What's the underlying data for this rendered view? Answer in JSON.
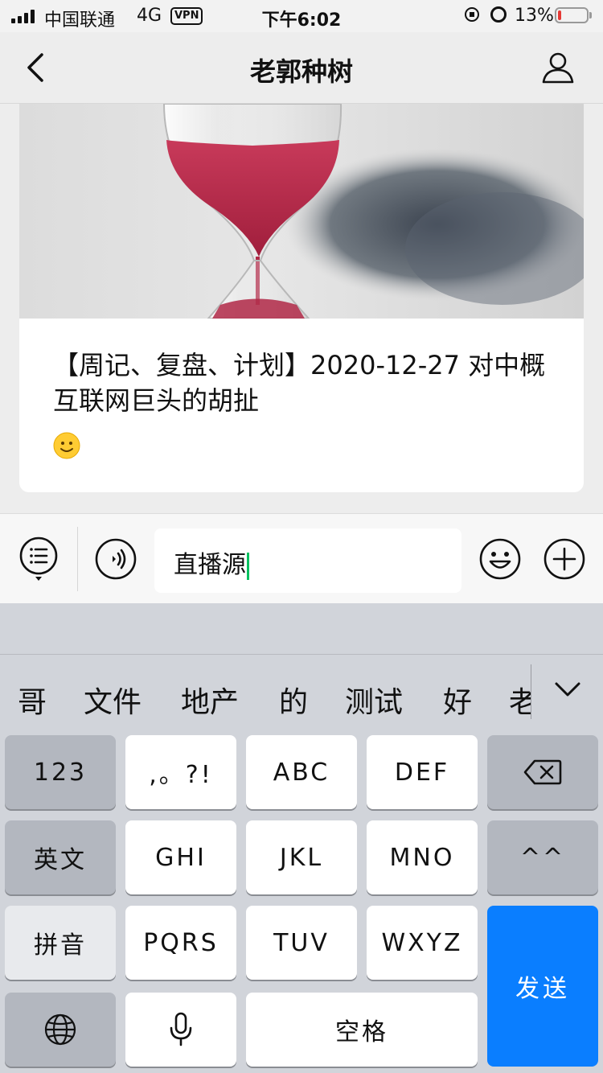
{
  "status_bar": {
    "carrier": "中国联通",
    "network": "4G",
    "vpn": "VPN",
    "time": "下午6:02",
    "battery": "13%",
    "battery_level": 0.13
  },
  "nav": {
    "title": "老郭种树"
  },
  "article": {
    "title": "【周记、复盘、计划】2020-12-27 对中概互联网巨头的胡扯"
  },
  "input": {
    "value": "直播源"
  },
  "keyboard": {
    "candidates": [
      "哥",
      "文件",
      "地产",
      "的",
      "测试",
      "好",
      "老"
    ],
    "row1": [
      "123",
      ",。?!",
      "ABC",
      "DEF"
    ],
    "row2": [
      "英文",
      "GHI",
      "JKL",
      "MNO",
      "^^"
    ],
    "row3": [
      "拼音",
      "PQRS",
      "TUV",
      "WXYZ"
    ],
    "row4": [
      "空格"
    ],
    "send": "发送"
  },
  "colors": {
    "send_key": "#0a7eff",
    "caret": "#07c160",
    "battery_low": "#e53935"
  }
}
